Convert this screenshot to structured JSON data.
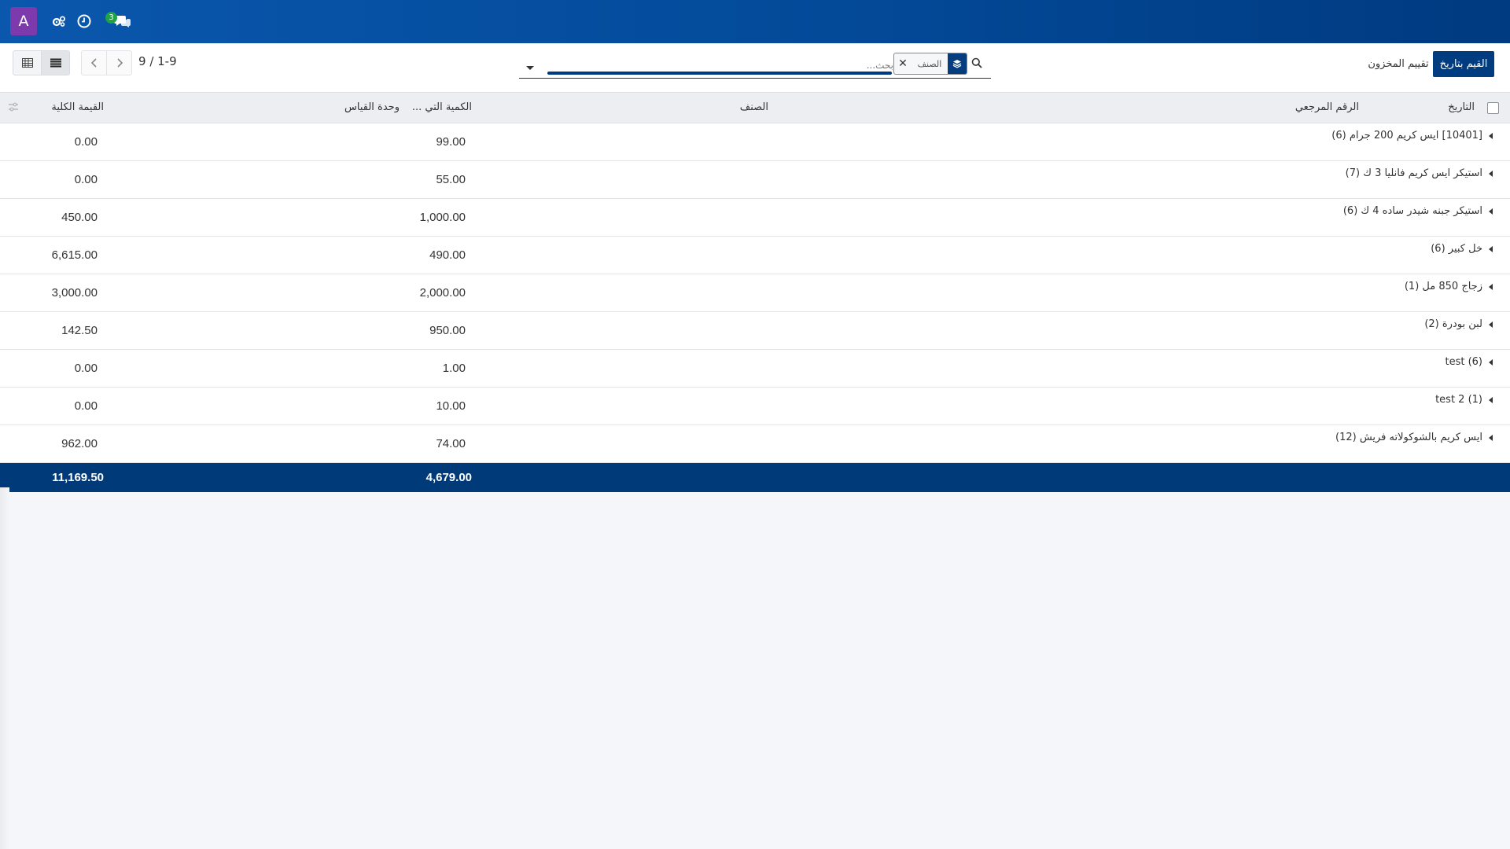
{
  "navbar": {
    "avatar_letter": "A",
    "icons": [
      "settings-cogs-icon",
      "clock-icon",
      "chat-icon"
    ],
    "chat_badge": "3"
  },
  "control_panel": {
    "buttons": {
      "primary": "القيم بتاريخ",
      "secondary": "تقييم المخزون"
    },
    "search": {
      "placeholder": "بحث...",
      "facet_value": "الصنف"
    },
    "pager": {
      "value": "1-9",
      "separator": " / ",
      "total": "9"
    },
    "views": [
      "pivot-view-icon",
      "list-view-icon"
    ]
  },
  "table": {
    "columns": {
      "date": "التاريخ",
      "reference": "الرقم المرجعي",
      "product": "الصنف",
      "quantity": "الكمية التي ...",
      "uom": "وحدة القياس",
      "total_value": "القيمة الكلية"
    },
    "groups": [
      {
        "label": "[10401] ايس كريم 200 جرام (6)",
        "quantity": "99.00",
        "value": "0.00"
      },
      {
        "label": "استيكر ايس كريم فانليا 3 ك (7)",
        "quantity": "55.00",
        "value": "0.00"
      },
      {
        "label": "استيكر جبنه شيدر ساده 4 ك (6)",
        "quantity": "1,000.00",
        "value": "450.00"
      },
      {
        "label": "خل كبير (6)",
        "quantity": "490.00",
        "value": "6,615.00"
      },
      {
        "label": "زجاج 850 مل (1)",
        "quantity": "2,000.00",
        "value": "3,000.00"
      },
      {
        "label": "لبن بودرة (2)",
        "quantity": "950.00",
        "value": "142.50"
      },
      {
        "label": "test (6)",
        "quantity": "1.00",
        "value": "0.00"
      },
      {
        "label": "test 2 (1)",
        "quantity": "10.00",
        "value": "0.00"
      },
      {
        "label": "ايس كريم بالشوكولاته فريش (12)",
        "quantity": "74.00",
        "value": "962.00"
      }
    ],
    "totals": {
      "quantity": "4,679.00",
      "value": "11,169.50"
    }
  },
  "colors": {
    "navbar": "#034a99",
    "primary_button": "#003c7f",
    "footer_row": "#003a78",
    "avatar": "#7c3aad",
    "badge": "#1fa345"
  }
}
